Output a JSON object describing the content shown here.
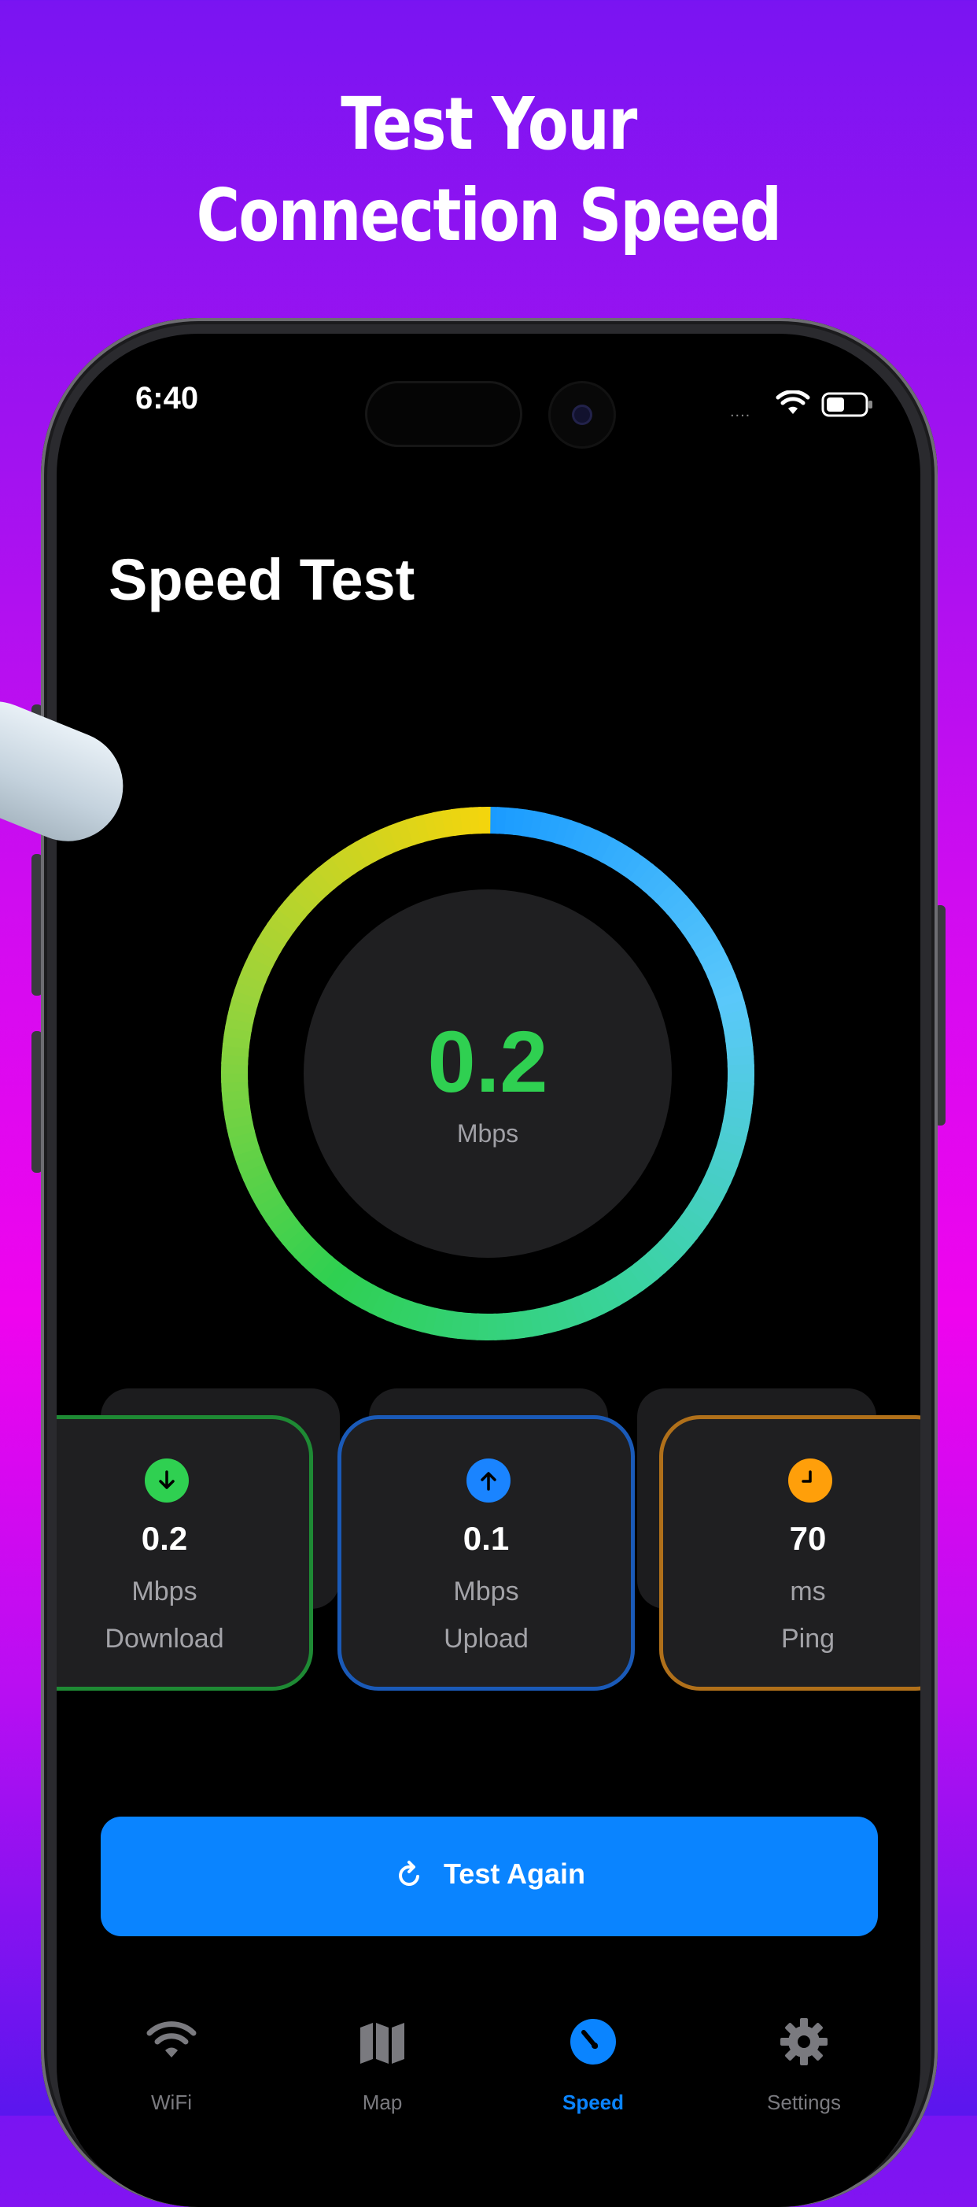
{
  "headline": {
    "line1": "Test Your",
    "line2": "Connection Speed"
  },
  "status_bar": {
    "time": "6:40",
    "signal": "...."
  },
  "page": {
    "title": "Speed Test"
  },
  "gauge": {
    "value": "0.2",
    "unit": "Mbps",
    "progress": 1.0,
    "colors": [
      "#1a9bff",
      "#5ac8fa",
      "#3ad3a0",
      "#2fd051",
      "#9cd33a",
      "#f5d50c"
    ]
  },
  "stats": [
    {
      "value": "0.2",
      "unit": "Mbps",
      "label": "Download",
      "icon": "arrow-down-icon",
      "color": "#2fd051"
    },
    {
      "value": "0.1",
      "unit": "Mbps",
      "label": "Upload",
      "icon": "arrow-up-icon",
      "color": "#1a84ff"
    },
    {
      "value": "70",
      "unit": "ms",
      "label": "Ping",
      "icon": "clock-icon",
      "color": "#ff9f0a"
    }
  ],
  "action": {
    "label": "Test Again",
    "icon": "refresh-icon",
    "color": "#0a84ff"
  },
  "tabbar": {
    "active": "Speed",
    "items": [
      {
        "label": "WiFi",
        "icon": "wifi-icon"
      },
      {
        "label": "Map",
        "icon": "map-icon"
      },
      {
        "label": "Speed",
        "icon": "speedometer-icon"
      },
      {
        "label": "Settings",
        "icon": "gear-icon"
      }
    ]
  }
}
